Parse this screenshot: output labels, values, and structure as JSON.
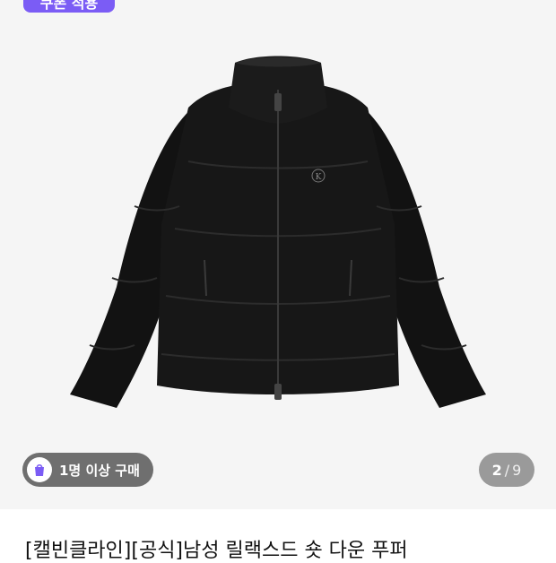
{
  "promo": {
    "label": "쿠폰 적용"
  },
  "social_proof": {
    "text": "1명 이상 구매",
    "icon": "shopping-bag-icon"
  },
  "pager": {
    "current": "2",
    "separator": "/",
    "total": "9"
  },
  "product": {
    "title": "[캘빈클라인][공식]남성 릴랙스드 숏 다운 푸퍼"
  },
  "colors": {
    "accent": "#7b5cf5",
    "pill_bg": "#6f6f6f",
    "pager_bg": "#9a9a9a",
    "hero_bg": "#f5f5f5"
  }
}
